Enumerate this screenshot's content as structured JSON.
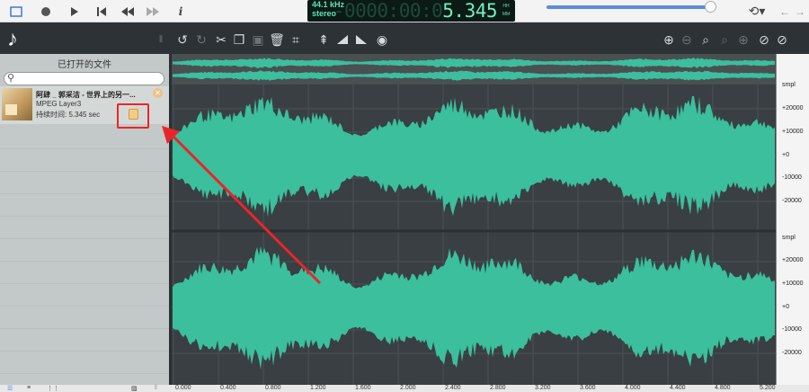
{
  "lcd": {
    "rate": "44.1 kHz",
    "channels": "stereo",
    "time_dim": "-0000:00:0",
    "time_lit": "5.345",
    "side_top": "HH",
    "side_bottom": "MM"
  },
  "panel": {
    "title": "已打开的文件",
    "search_placeholder": "",
    "file": {
      "title": "阿肆 _ 郭采洁 - 世界上的另一...",
      "format": "MPEG Layer3",
      "duration": "持续时间: 5.345 sec"
    }
  },
  "ruler": {
    "top": [
      "smpl",
      "+20000",
      "+10000",
      "+0",
      "-10000",
      "-20000"
    ],
    "bottom": [
      "smpl",
      "+20000",
      "+10000",
      "+0",
      "-10000",
      "-20000"
    ]
  },
  "timeline": [
    "0.000",
    "0.400",
    "0.800",
    "1.200",
    "1.600",
    "2.000",
    "2.400",
    "2.800",
    "3.200",
    "3.600",
    "4.000",
    "4.400",
    "4.800",
    "5.200"
  ],
  "colors": {
    "wave": "#3bbf9c",
    "highlight": "#e8262a"
  }
}
